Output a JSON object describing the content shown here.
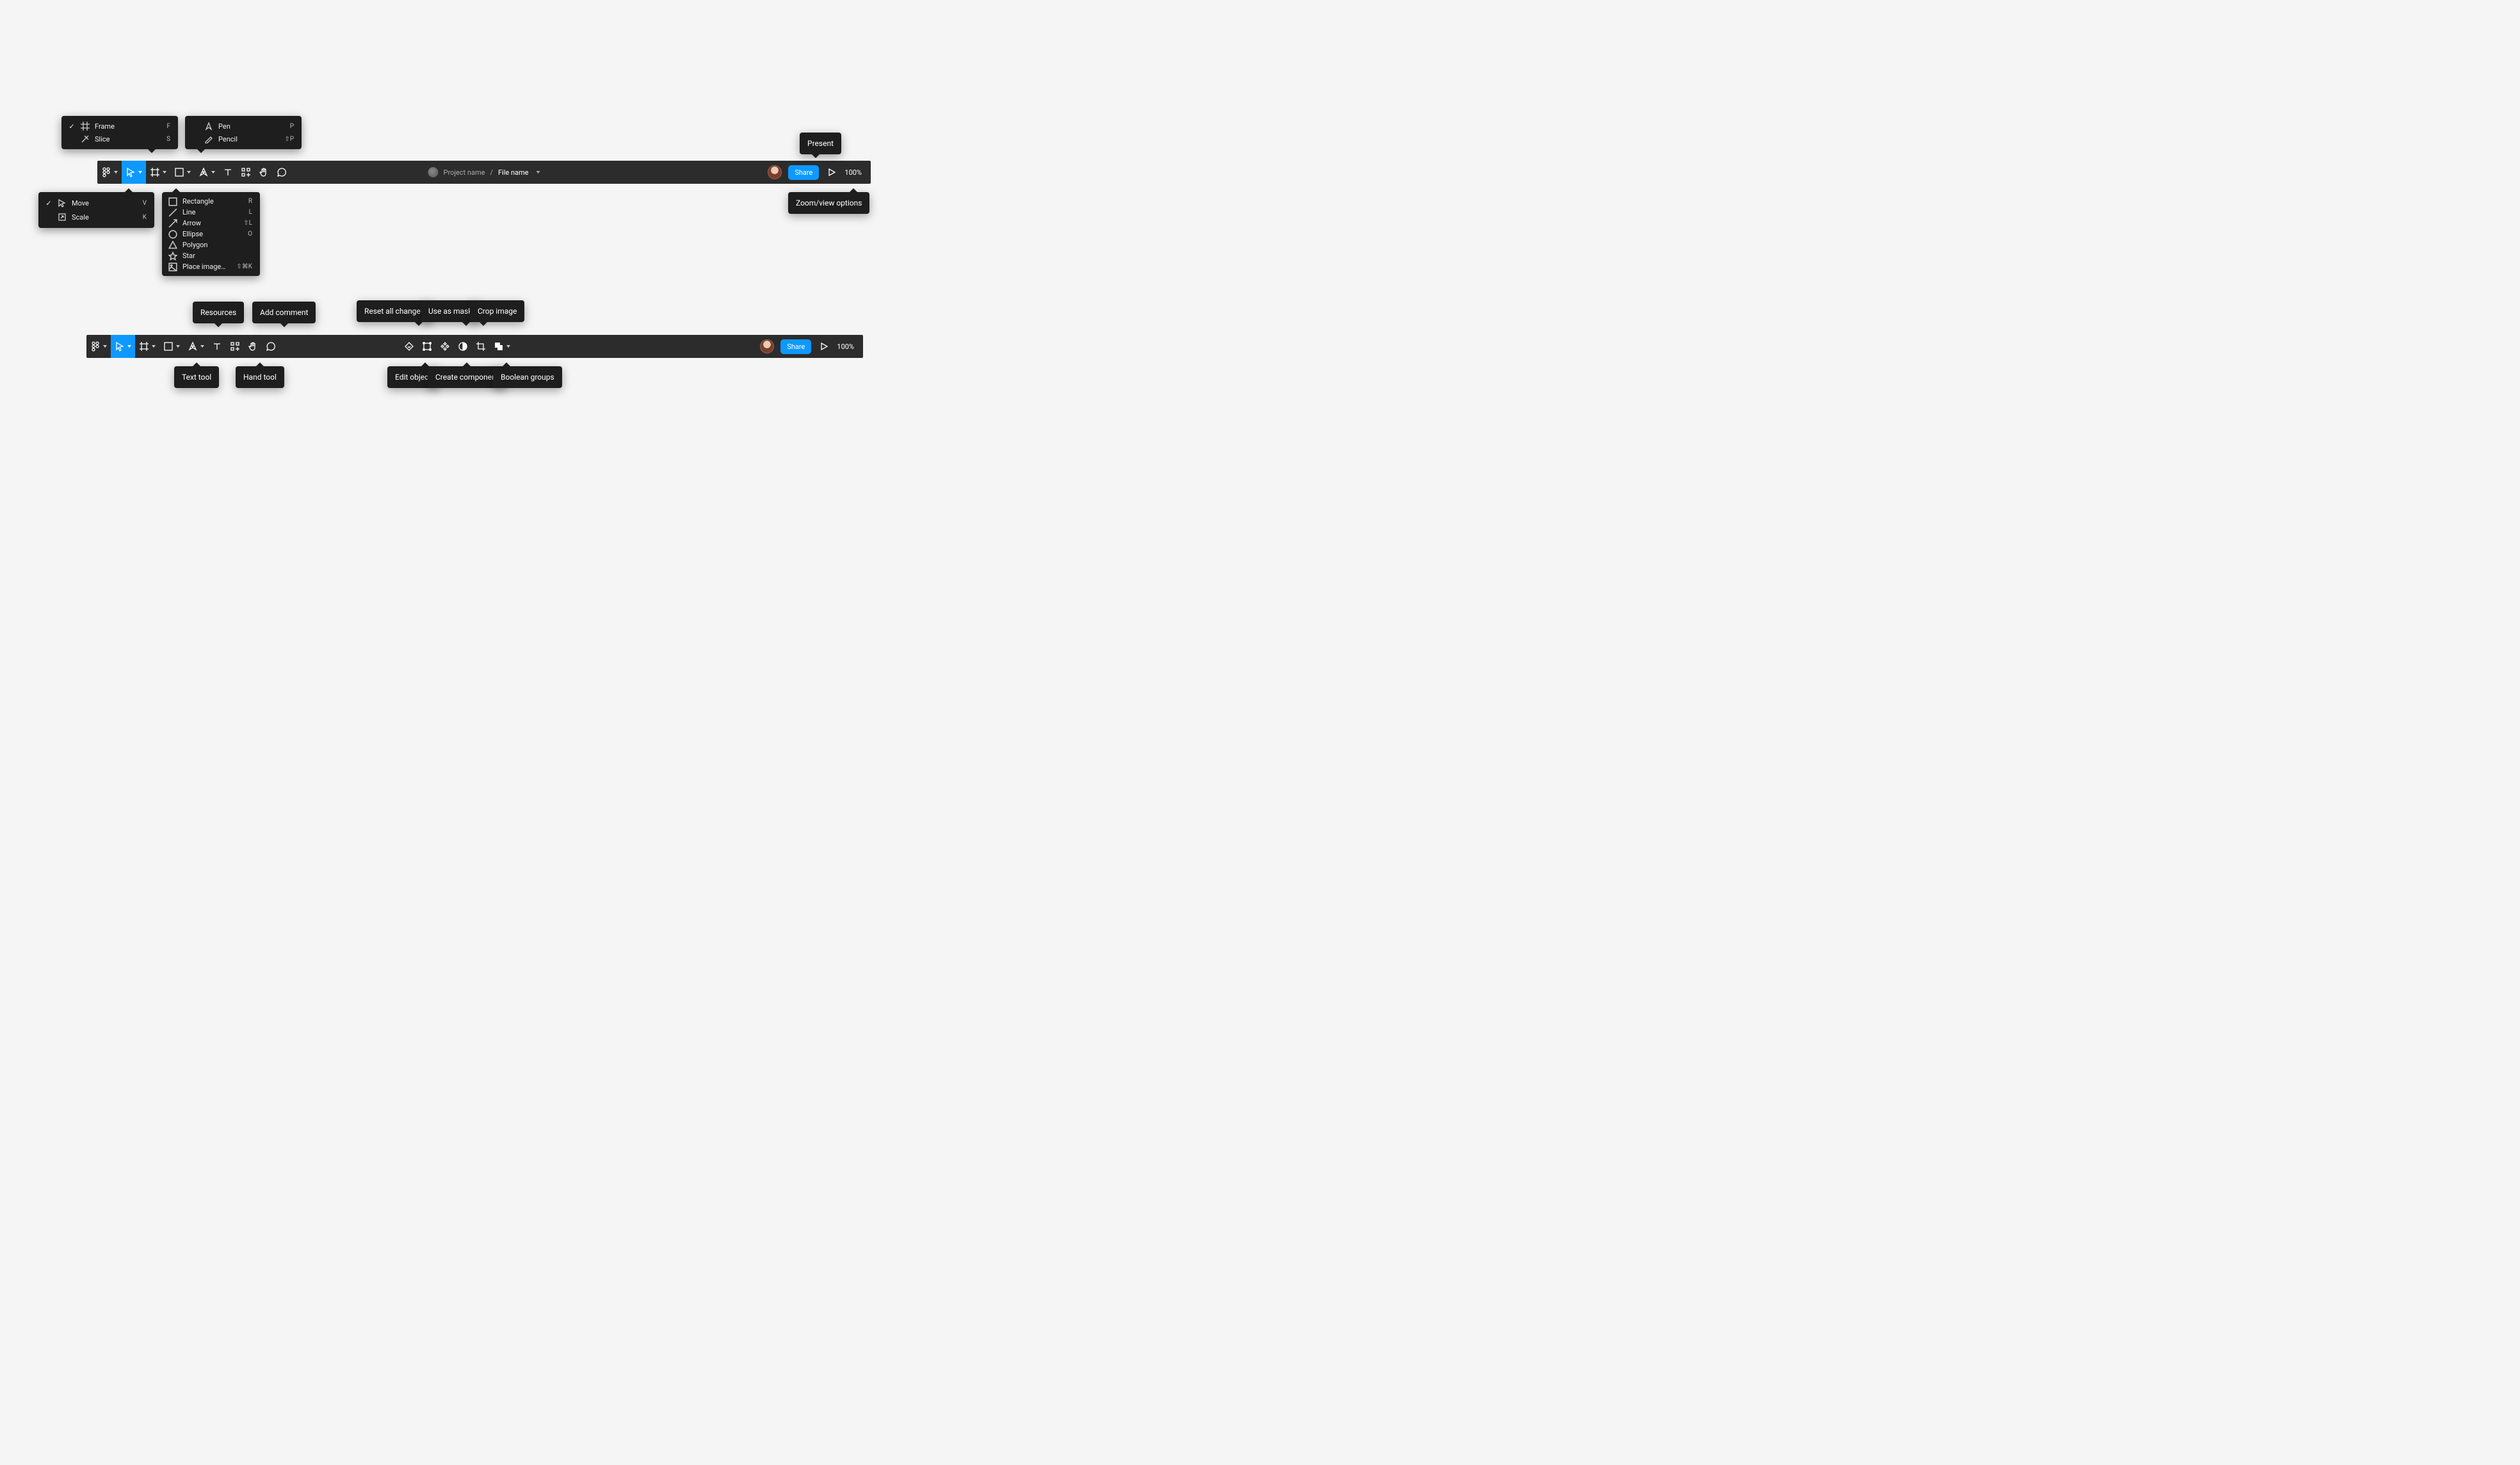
{
  "toolbar": {
    "project_name": "Project name",
    "file_name": "File name",
    "share_label": "Share",
    "zoom": "100%"
  },
  "menus": {
    "move": {
      "items": [
        {
          "label": "Move",
          "shortcut": "V",
          "checked": true
        },
        {
          "label": "Scale",
          "shortcut": "K",
          "checked": false
        }
      ]
    },
    "frame": {
      "items": [
        {
          "label": "Frame",
          "shortcut": "F",
          "checked": true
        },
        {
          "label": "Slice",
          "shortcut": "S",
          "checked": false
        }
      ]
    },
    "shapes": {
      "items": [
        {
          "label": "Rectangle",
          "shortcut": "R"
        },
        {
          "label": "Line",
          "shortcut": "L"
        },
        {
          "label": "Arrow",
          "shortcut": "⇧L"
        },
        {
          "label": "Ellipse",
          "shortcut": "O"
        },
        {
          "label": "Polygon",
          "shortcut": ""
        },
        {
          "label": "Star",
          "shortcut": ""
        },
        {
          "label": "Place image…",
          "shortcut": "⇧⌘K"
        }
      ]
    },
    "pen": {
      "items": [
        {
          "label": "Pen",
          "shortcut": "P"
        },
        {
          "label": "Pencil",
          "shortcut": "⇧P"
        }
      ]
    }
  },
  "tips": {
    "present": "Present",
    "zoom_view": "Zoom/view options",
    "resources": "Resources",
    "add_comment": "Add comment",
    "text_tool": "Text tool",
    "hand_tool": "Hand tool",
    "reset_all": "Reset all changes",
    "use_as_mask": "Use as mask",
    "crop_image": "Crop image",
    "edit_object": "Edit object",
    "create_component": "Create component",
    "boolean_groups": "Boolean groups"
  }
}
